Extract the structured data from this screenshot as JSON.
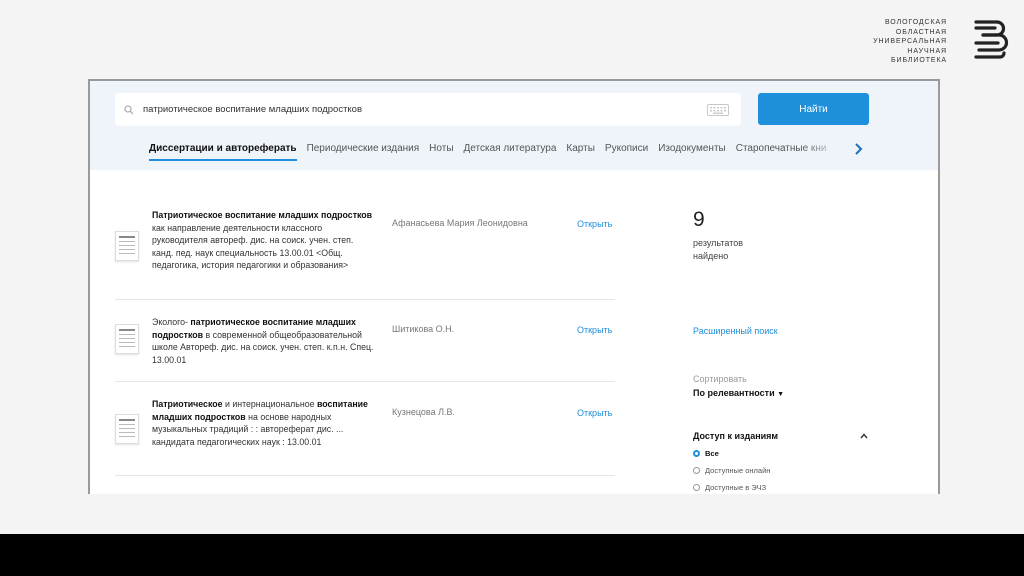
{
  "logo": {
    "lines": [
      "ВОЛОГОДСКАЯ",
      "ОБЛАСТНАЯ",
      "УНИВЕРСАЛЬНАЯ",
      "НАУЧНАЯ",
      "БИБЛИОТЕКА"
    ]
  },
  "search": {
    "value": "патриотическое воспитание младших подростков",
    "button_label": "Найти"
  },
  "tabs": [
    {
      "label": "Диссертации и автореферать",
      "active": true
    },
    {
      "label": "Периодические издания"
    },
    {
      "label": "Ноты"
    },
    {
      "label": "Детская литература"
    },
    {
      "label": "Карты"
    },
    {
      "label": "Рукописи"
    },
    {
      "label": "Изодокументы"
    },
    {
      "label": "Старопечатные кни"
    }
  ],
  "results": [
    {
      "title_bold": "Патриотическое воспитание младших подростков",
      "title_rest": " как направление деятельности классного руководителя автореф. дис. на соиск. учен. степ. канд. пед. наук специальность 13.00.01 <Общ. педагогика, история педагогики и образования>",
      "author": "Афанасьева Мария Леонидовна",
      "open_label": "Открыть"
    },
    {
      "title_prefix": "Эколого- ",
      "title_bold": "патриотическое воспитание младших подростков",
      "title_rest": " в современной общеобразовательной школе Автореф. дис. на соиск. учен. степ. к.п.н. Спец. 13.00.01",
      "author": "Шитикова О.Н.",
      "open_label": "Открыть"
    },
    {
      "title_bold_a": "Патриотическое",
      "title_mid": " и интернациональное ",
      "title_bold": "воспитание младших подростков",
      "title_rest": " на основе народных музыкальных традиций : : автореферат дис. ... кандидата педагогических наук : 13.00.01",
      "author": "Кузнецова Л.В.",
      "open_label": "Открыть"
    }
  ],
  "sidebar": {
    "count": "9",
    "count_label": "результатов найдено",
    "advanced_search": "Расширенный поиск",
    "sort_label": "Сортировать",
    "sort_value": "По релевантности",
    "access_title": "Доступ к изданиям",
    "access_options": [
      {
        "label": "Все",
        "selected": true
      },
      {
        "label": "Доступные онлайн"
      },
      {
        "label": "Доступные в ЭЧЗ"
      }
    ]
  },
  "colors": {
    "accent": "#1d8fdb",
    "band": "#eef4f9",
    "letterbox": "#000000"
  }
}
